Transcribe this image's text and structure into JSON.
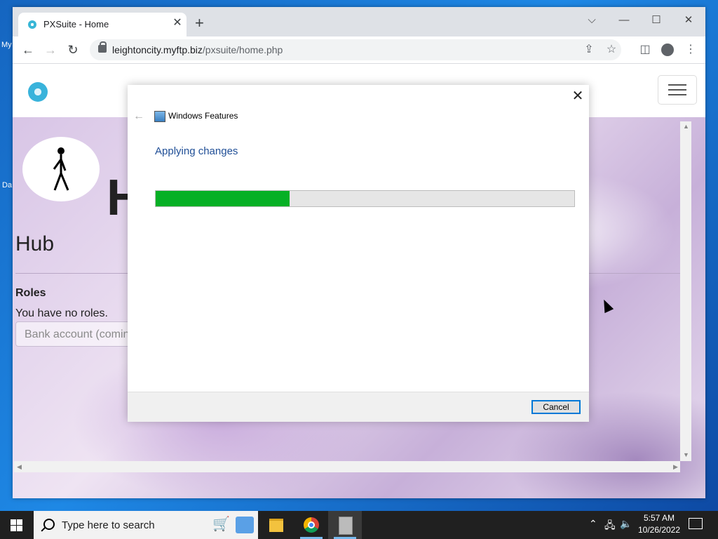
{
  "desktop": {
    "label_1": "My",
    "label_2": "Da"
  },
  "browser": {
    "tab_title": "PXSuite - Home",
    "new_tab": "+",
    "url_host": "leightoncity.myftp.biz",
    "url_path": "/pxsuite/home.php"
  },
  "site": {
    "big_letter": "H",
    "page_title": "Hub",
    "roles_heading": "Roles",
    "no_roles_text": "You have no roles.",
    "bank_input_placeholder": "Bank account (coming soon)"
  },
  "dialog": {
    "window_title": "Windows Features",
    "heading": "Applying changes",
    "progress_fraction": 0.32,
    "cancel_label": "Cancel",
    "progress_color": "#06b025"
  },
  "taskbar": {
    "search_placeholder": "Type here to search",
    "time": "5:57 AM",
    "date": "10/26/2022"
  }
}
